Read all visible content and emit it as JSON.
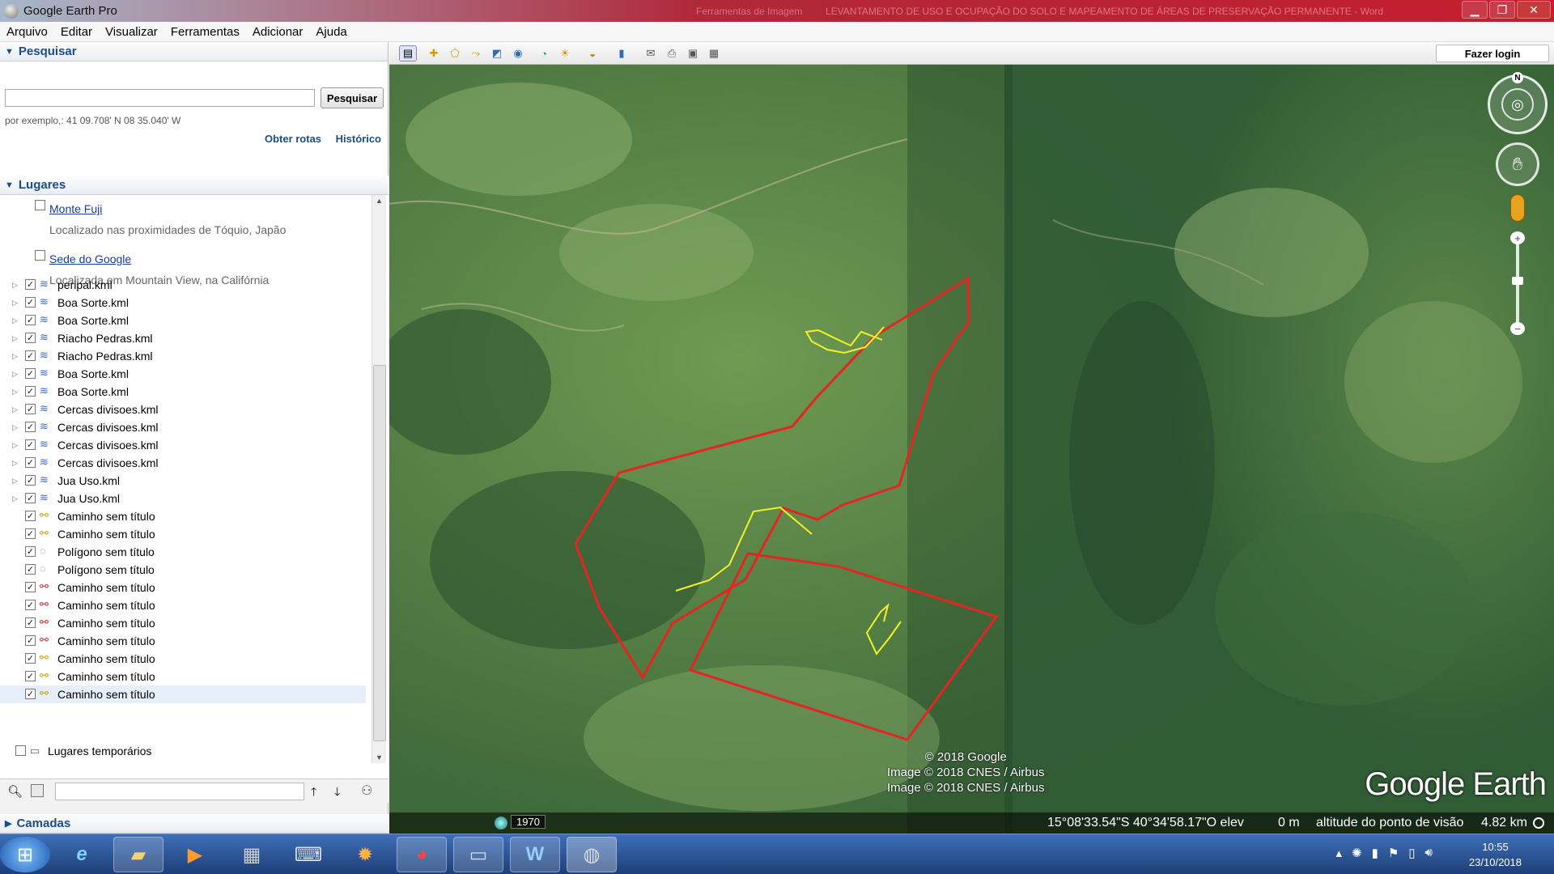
{
  "window": {
    "title": "Google Earth Pro",
    "ghost_title": "Ferramentas de Imagem",
    "ghost_title2": "LEVANTAMENTO DE USO E OCUPAÇÃO DO SOLO E MAPEAMENTO DE ÁREAS DE PRESERVAÇÃO PERMANENTE - Word",
    "min": "▁",
    "max": "❐",
    "close": "✕"
  },
  "menu": [
    "Arquivo",
    "Editar",
    "Visualizar",
    "Ferramentas",
    "Adicionar",
    "Ajuda"
  ],
  "search": {
    "header": "Pesquisar",
    "button": "Pesquisar",
    "value": "",
    "placeholder": "",
    "hint": "por exemplo,: 41 09.708' N 08 35.040' W",
    "routes": "Obter rotas",
    "history": "Histórico"
  },
  "places": {
    "header": "Lugares",
    "sample1": {
      "name": "Monte Fuji",
      "desc": "Localizado nas proximidades de Tóquio, Japão"
    },
    "sample2": {
      "name": "Sede do Google",
      "desc": "Localizada em Mountain View, na Califórnia"
    },
    "items": [
      {
        "label": "peripal.kml",
        "icon": "kml-icon"
      },
      {
        "label": "Boa Sorte.kml",
        "icon": "kml-icon"
      },
      {
        "label": "Boa Sorte.kml",
        "icon": "kml-icon"
      },
      {
        "label": "Riacho Pedras.kml",
        "icon": "kml-icon"
      },
      {
        "label": "Riacho Pedras.kml",
        "icon": "kml-icon"
      },
      {
        "label": "Boa Sorte.kml",
        "icon": "kml-icon"
      },
      {
        "label": "Boa Sorte.kml",
        "icon": "kml-icon"
      },
      {
        "label": "Cercas divisoes.kml",
        "icon": "kml-icon"
      },
      {
        "label": "Cercas divisoes.kml",
        "icon": "kml-icon"
      },
      {
        "label": "Cercas divisoes.kml",
        "icon": "kml-icon"
      },
      {
        "label": "Cercas divisoes.kml",
        "icon": "kml-icon"
      },
      {
        "label": "Jua Uso.kml",
        "icon": "kml-icon"
      },
      {
        "label": "Jua Uso.kml",
        "icon": "kml-icon"
      },
      {
        "label": "Caminho sem título",
        "icon": "path-yellow-icon"
      },
      {
        "label": "Caminho sem título",
        "icon": "path-yellow-icon"
      },
      {
        "label": "Polígono sem título",
        "icon": "polygon-icon"
      },
      {
        "label": "Polígono sem título",
        "icon": "polygon-icon"
      },
      {
        "label": "Caminho sem título",
        "icon": "path-red-icon"
      },
      {
        "label": "Caminho sem título",
        "icon": "path-red-icon"
      },
      {
        "label": "Caminho sem título",
        "icon": "path-red-icon"
      },
      {
        "label": "Caminho sem título",
        "icon": "path-red-icon"
      },
      {
        "label": "Caminho sem título",
        "icon": "path-yellow-icon"
      },
      {
        "label": "Caminho sem título",
        "icon": "path-yellow-icon"
      },
      {
        "label": "Caminho sem título",
        "icon": "path-yellow-icon"
      }
    ],
    "temp": "Lugares temporários"
  },
  "layers": {
    "header": "Camadas"
  },
  "toolbar": {
    "login": "Fazer login"
  },
  "map": {
    "credit1": "© 2018 Google",
    "credit2": "Image © 2018 CNES / Airbus",
    "credit3": "Image © 2018 CNES / Airbus",
    "brand": "Google Earth",
    "year": "1970",
    "compass_n": "N",
    "coords": "15°08'33.54\"S  40°34'58.17\"O  elev",
    "elev": "0 m",
    "eye_alt_label": "altitude do ponto de visão",
    "eye_alt": "4.82 km"
  },
  "taskbar": {
    "time": "10:55",
    "date": "23/10/2018"
  },
  "colors": {
    "boundary": "#e52521",
    "subarea": "#f2f227",
    "accent": "#1a4d8c"
  }
}
